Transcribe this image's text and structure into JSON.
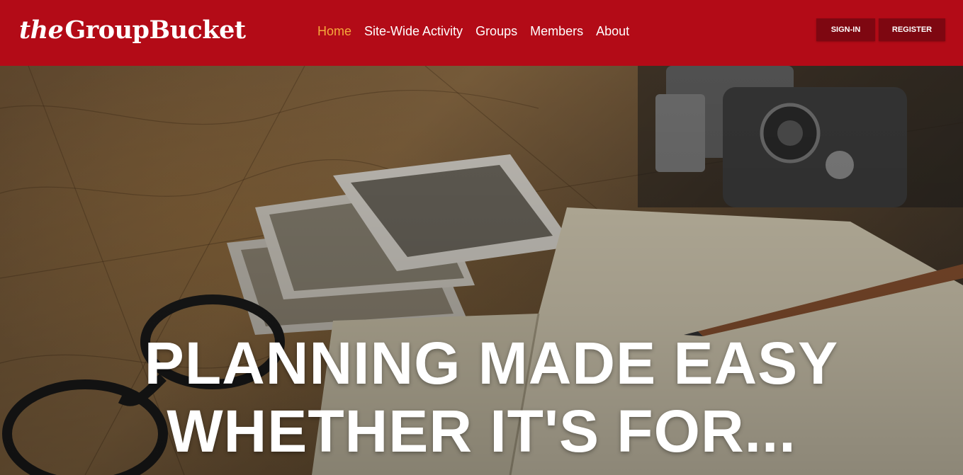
{
  "brand": {
    "logo_prefix": "the",
    "logo_main": "GroupBucket"
  },
  "nav": {
    "items": [
      {
        "label": "Home",
        "active": true
      },
      {
        "label": "Site-Wide Activity",
        "active": false
      },
      {
        "label": "Groups",
        "active": false
      },
      {
        "label": "Members",
        "active": false
      },
      {
        "label": "About",
        "active": false
      }
    ]
  },
  "auth": {
    "signin_label": "SIGN-IN",
    "register_label": "REGISTER"
  },
  "hero": {
    "headline_line1": "PLANNING MADE EASY",
    "headline_line2": "WHETHER IT'S FOR..."
  },
  "colors": {
    "header_bg": "#b30b17",
    "button_bg": "#7e0711",
    "active_nav": "#f5a93c",
    "text": "#ffffff"
  }
}
